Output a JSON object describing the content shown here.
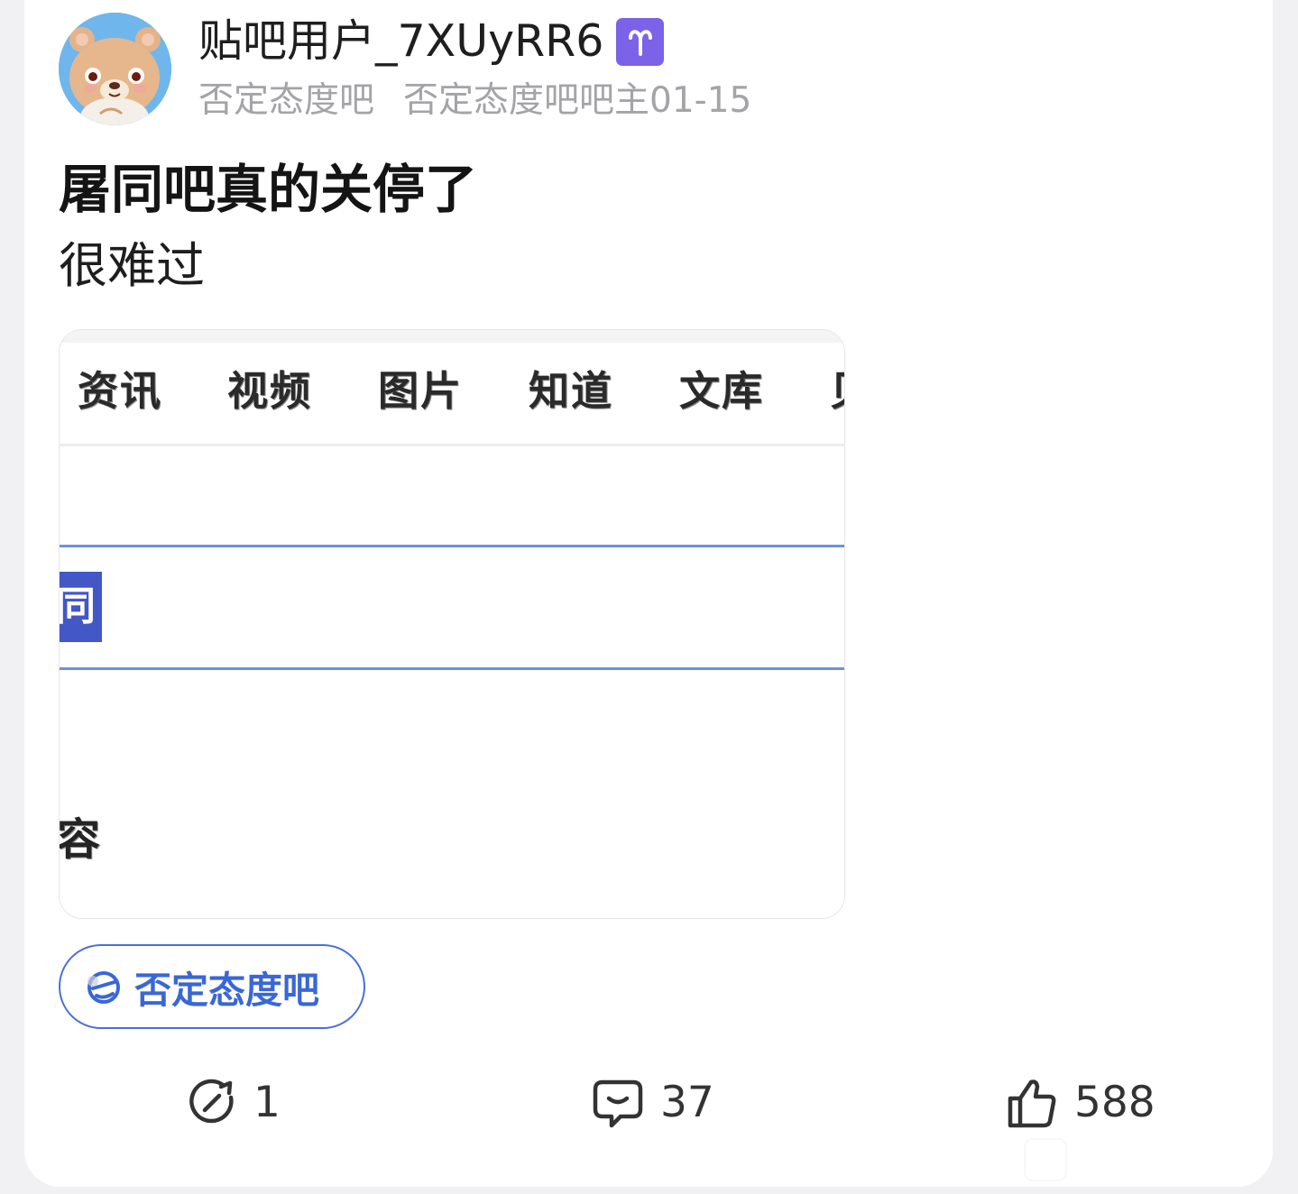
{
  "post": {
    "username": "贴吧用户_7XUyRR6",
    "zodiac_symbol": "♈",
    "forum": "否定态度吧",
    "role_date": "否定态度吧吧主01-15",
    "title": "屠同吧真的关停了",
    "body": "很难过"
  },
  "screenshot": {
    "tabs": [
      "资讯",
      "视频",
      "图片",
      "知道",
      "文库",
      "贝"
    ],
    "highlight_char": "同",
    "bottom_char": "容"
  },
  "forum_tag": {
    "label": "否定态度吧",
    "icon": "forum-logo-icon"
  },
  "actions": {
    "share_count": "1",
    "comment_count": "37",
    "like_count": "588"
  },
  "colors": {
    "accent_blue": "#3a67d6",
    "zodiac_bg": "#7b62e8",
    "avatar_bg": "#6fb6ec",
    "highlight_bg": "#4357c7",
    "meta_gray": "#a4a4a8"
  }
}
